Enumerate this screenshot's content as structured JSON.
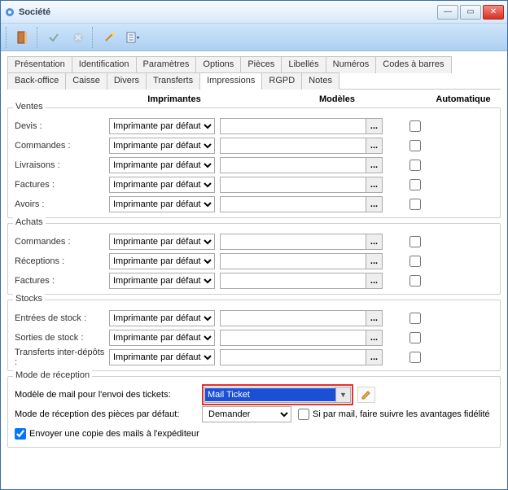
{
  "window": {
    "title": "Société"
  },
  "toolbar": {
    "icons": [
      "door",
      "check",
      "x",
      "wand",
      "doc-dd"
    ]
  },
  "tabs_row1": [
    "Présentation",
    "Identification",
    "Paramètres",
    "Options",
    "Pièces",
    "Libellés",
    "Numéros",
    "Codes à barres",
    "Back-office",
    "Caisse"
  ],
  "tabs_row2": [
    "Divers",
    "Transferts",
    "Impressions",
    "RGPD",
    "Notes"
  ],
  "active_tab": "Impressions",
  "columns": {
    "printers": "Imprimantes",
    "models": "Modèles",
    "auto": "Automatique"
  },
  "default_printer": "Imprimante par défaut",
  "model_browse": "...",
  "groups": {
    "ventes": {
      "title": "Ventes",
      "rows": [
        "Devis :",
        "Commandes :",
        "Livraisons :",
        "Factures :",
        "Avoirs :"
      ]
    },
    "achats": {
      "title": "Achats",
      "rows": [
        "Commandes :",
        "Réceptions :",
        "Factures :"
      ]
    },
    "stocks": {
      "title": "Stocks",
      "rows": [
        "Entrées de stock :",
        "Sorties de stock :",
        "Transferts inter-dépôts :"
      ]
    }
  },
  "mode": {
    "title": "Mode de réception",
    "mail_model_label": "Modèle de mail pour l'envoi des tickets:",
    "mail_model_value": "Mail Ticket",
    "default_mode_label": "Mode de réception des pièces par défaut:",
    "default_mode_value": "Demander",
    "forward_label": "Si par mail, faire suivre les avantages fidélité",
    "forward_checked": false,
    "copy_label": "Envoyer une copie des mails à l'expéditeur",
    "copy_checked": true
  }
}
